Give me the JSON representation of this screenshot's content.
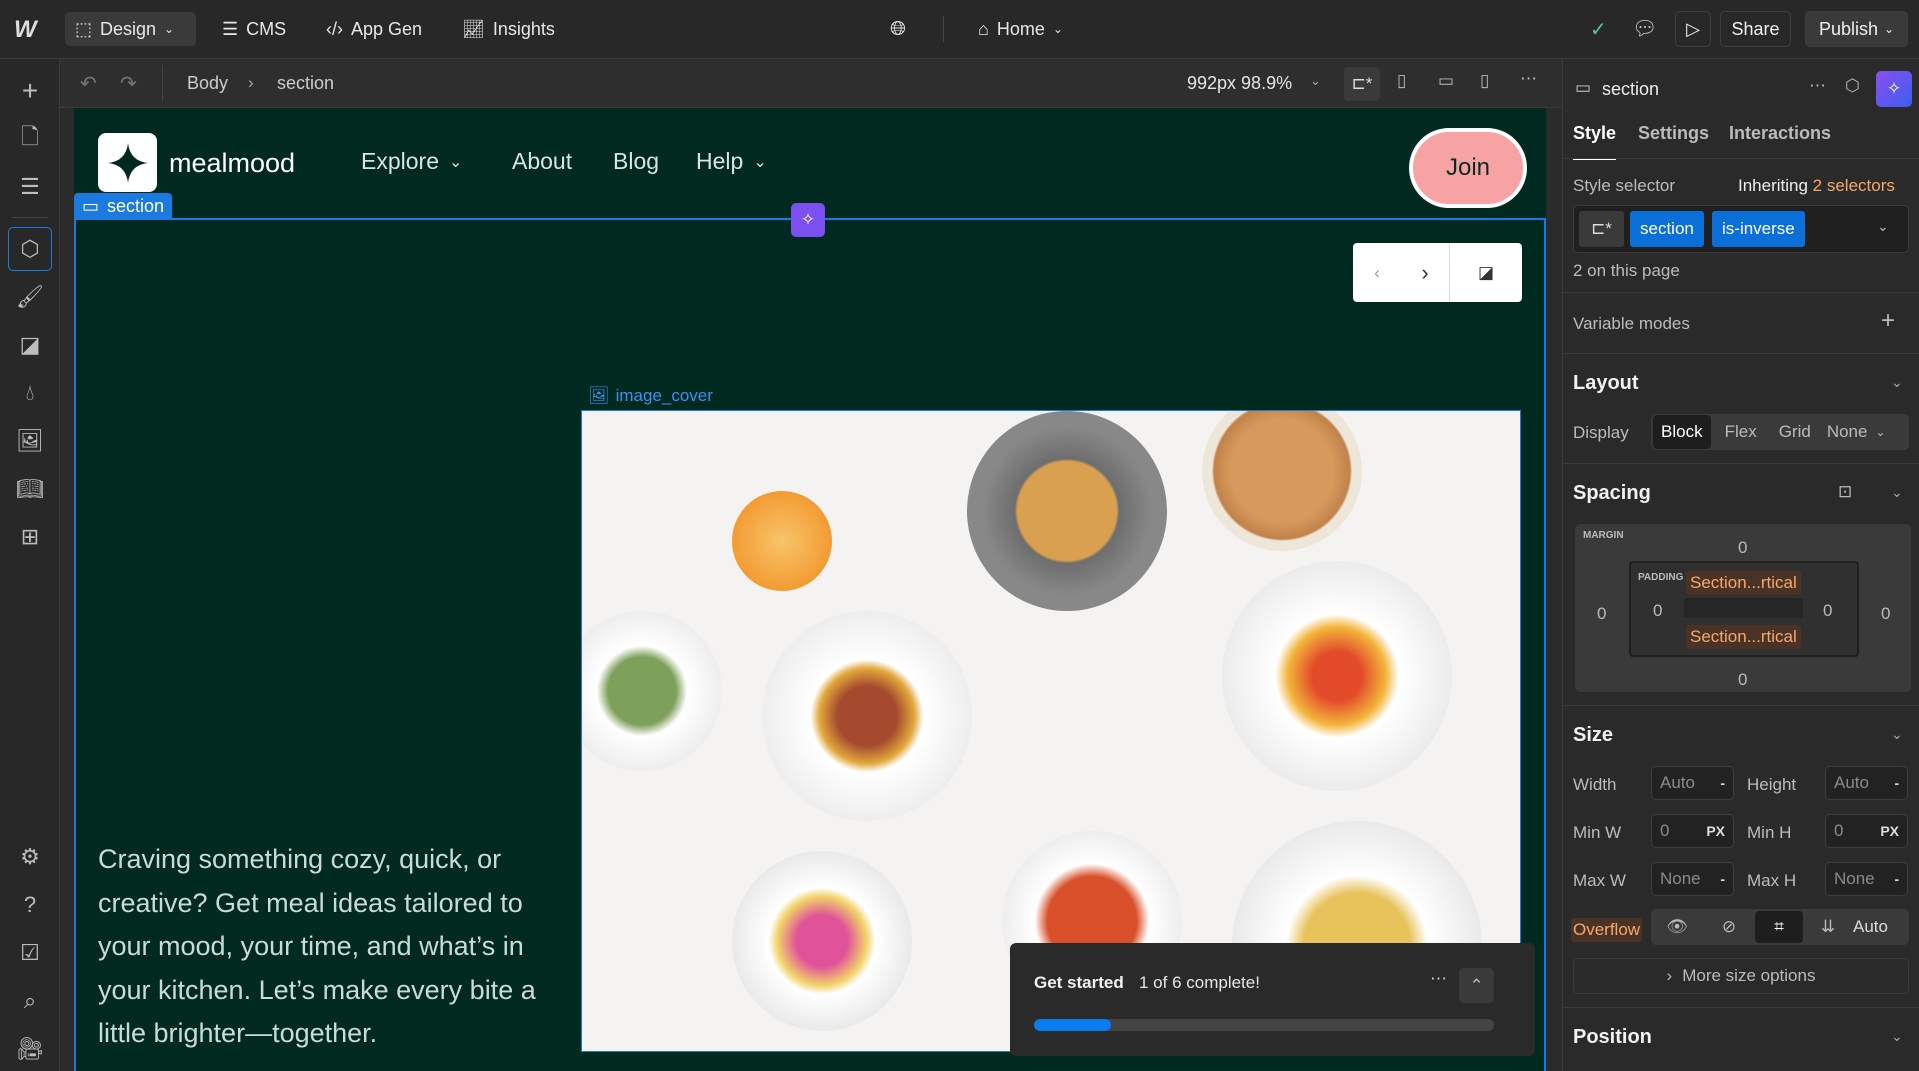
{
  "topbar": {
    "design": "Design",
    "cms": "CMS",
    "appgen": "App Gen",
    "insights": "Insights",
    "page": "Home",
    "share": "Share",
    "publish": "Publish"
  },
  "subbar": {
    "crumbs": [
      "Body",
      "section"
    ],
    "viewport": "992px 98.9%"
  },
  "site": {
    "brand": "mealmood",
    "nav": [
      "Explore",
      "About",
      "Blog",
      "Help"
    ],
    "join": "Join",
    "section_label": "section",
    "image_label": "image_cover",
    "paragraph": "Craving something cozy, quick, or creative? Get meal ideas tailored to your mood, your time, and what’s in your kitchen. Let’s make every bite a little brighter—together."
  },
  "getstarted": {
    "title": "Get started",
    "status": "1 of 6 complete!",
    "progress": 0.1667
  },
  "panel": {
    "element": "section",
    "tabs": [
      "Style",
      "Settings",
      "Interactions"
    ],
    "style_selector": "Style selector",
    "inheriting": "Inheriting",
    "inheriting_count": "2 selectors",
    "selectors": [
      "section",
      "is-inverse"
    ],
    "on_page": "2 on this page",
    "variable_modes": "Variable modes",
    "layout": {
      "title": "Layout",
      "display_label": "Display",
      "options": [
        "Block",
        "Flex",
        "Grid",
        "None"
      ],
      "active": "Block"
    },
    "spacing": {
      "title": "Spacing",
      "margin_label": "MARGIN",
      "padding_label": "PADDING",
      "margin": {
        "top": "0",
        "right": "0",
        "bottom": "0",
        "left": "0"
      },
      "padding": {
        "top": "Section...rtical",
        "right": "0",
        "bottom": "Section...rtical",
        "left": "0"
      }
    },
    "size": {
      "title": "Size",
      "width_label": "Width",
      "width": "Auto",
      "height_label": "Height",
      "height": "Auto",
      "minw_label": "Min W",
      "minw": "0",
      "minh_label": "Min H",
      "minh": "0",
      "unit": "PX",
      "maxw_label": "Max W",
      "maxw": "None",
      "maxh_label": "Max H",
      "maxh": "None",
      "dash": "-",
      "overflow_label": "Overflow",
      "overflow_auto": "Auto",
      "more": "More size options"
    },
    "position": {
      "title": "Position"
    }
  },
  "colors": {
    "accent": "#0073e6",
    "canvas": "#00291f",
    "join": "#f7a3a3",
    "orange": "#f5a86b",
    "ai": "#7b4ff0"
  }
}
